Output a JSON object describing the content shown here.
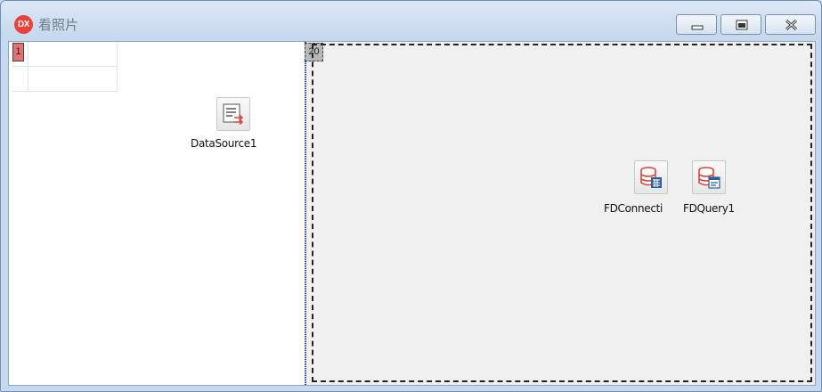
{
  "window": {
    "title": "看照片",
    "logo_text": "DX",
    "logo_color": "#e8433a"
  },
  "caption_buttons": [
    "minimize-icon",
    "restore-icon",
    "close-icon"
  ],
  "panels": {
    "left_tag": "1",
    "right_tag": "20"
  },
  "components": {
    "datasource": {
      "label": "DataSource1",
      "icon": "datasource-icon"
    },
    "fdconnection": {
      "label": "FDConnecti",
      "icon": "database-connection-icon"
    },
    "fdquery": {
      "label": "FDQuery1",
      "icon": "database-query-icon"
    }
  }
}
